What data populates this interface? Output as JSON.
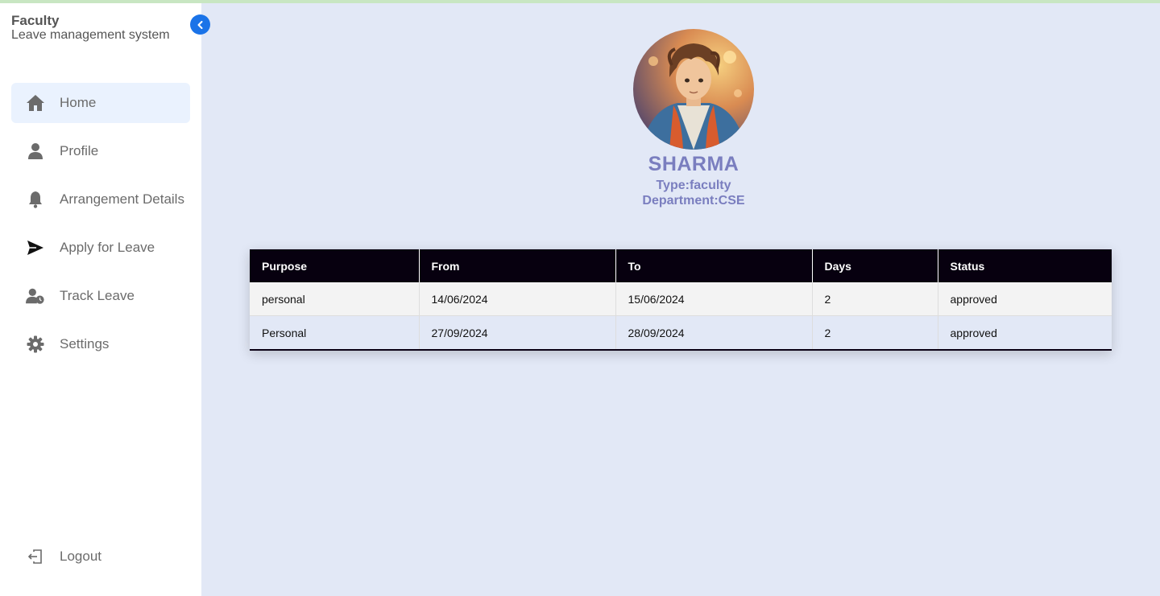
{
  "sidebar": {
    "title": "Faculty",
    "subtitle": "Leave management system",
    "collapse_icon": "chevron-left-icon",
    "items": [
      {
        "label": "Home",
        "icon": "home-icon",
        "active": true
      },
      {
        "label": "Profile",
        "icon": "user-icon",
        "active": false
      },
      {
        "label": "Arrangement Details",
        "icon": "bell-icon",
        "active": false
      },
      {
        "label": "Apply for Leave",
        "icon": "send-icon",
        "active": false
      },
      {
        "label": "Track Leave",
        "icon": "user-clock-icon",
        "active": false
      },
      {
        "label": "Settings",
        "icon": "gear-icon",
        "active": false
      }
    ],
    "logout": {
      "label": "Logout",
      "icon": "logout-icon"
    }
  },
  "profile": {
    "name": "SHARMA",
    "type_label": "Type:",
    "type_value": "faculty",
    "department_label": "Department:",
    "department_value": "CSE"
  },
  "table": {
    "headers": [
      "Purpose",
      "From",
      "To",
      "Days",
      "Status"
    ],
    "rows": [
      [
        "personal",
        "14/06/2024",
        "15/06/2024",
        "2",
        "approved"
      ],
      [
        "Personal",
        "27/09/2024",
        "28/09/2024",
        "2",
        "approved"
      ]
    ]
  },
  "colors": {
    "accent": "#1a73e8",
    "profile_text": "#7a7ebf",
    "table_header": "#07000f",
    "main_bg": "#e2e8f6"
  }
}
